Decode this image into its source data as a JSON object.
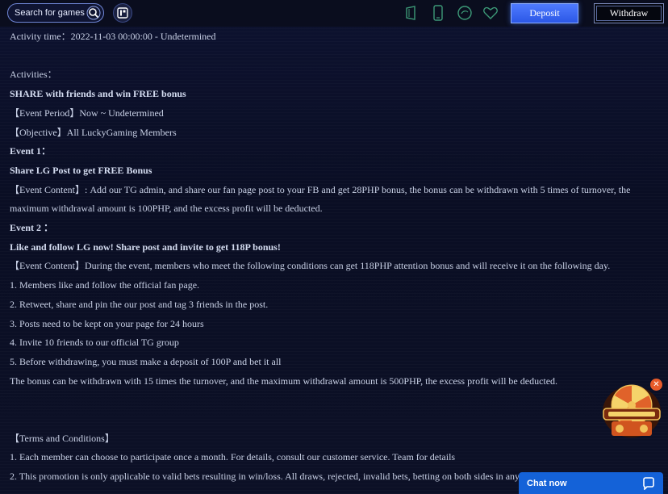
{
  "header": {
    "search_placeholder": "Search for games",
    "deposit_label": "Deposit",
    "withdraw_label": "Withdraw",
    "icons": [
      "search-icon",
      "menu-icon",
      "tablet-icon",
      "mobile-icon",
      "chat-bubble-icon",
      "heart-icon"
    ]
  },
  "content": {
    "activity_time": "Activity time：2022-11-03 00:00:00 - Undetermined",
    "activities_heading": "Activities：",
    "title": "SHARE with friends and win FREE bonus",
    "event_period": "【Event Period】Now ~ Undetermined",
    "objective": "【Objective】All LuckyGaming Members",
    "event1_heading": "Event 1：",
    "event1_title": "Share LG Post to get FREE Bonus",
    "event1_content_line1": "【Event Content】: Add our TG admin, and share our fan page post to your FB and get 28PHP bonus, the bonus can be withdrawn with 5 times of turnover, the",
    "event1_content_line2": "maximum withdrawal amount is 100PHP, and the excess profit will be deducted.",
    "event2_heading": "Event 2 ：",
    "event2_title": "Like and follow LG now! Share post and invite to get 118P bonus!",
    "event2_content": "【Event Content】During the event, members who meet the following conditions can get 118PHP attention bonus and will receive it on the following day.",
    "event2_conditions": [
      "1. Members like and follow the official fan page.",
      "2. Retweet, share and pin the our post and tag 3 friends in the post.",
      "3. Posts need to be kept on your page for 24 hours",
      "4. Invite 10 friends to our official TG group",
      "5. Before withdrawing, you must make a deposit of 100P and bet it all"
    ],
    "event2_bonus_note": "The bonus can be withdrawn with 15 times the turnover, and the maximum withdrawal amount is 500PHP,  the excess profit will be deducted.",
    "terms_heading": "【Terms and Conditions】",
    "terms": [
      "1. Each member can choose to participate once a month. For details, consult our customer service. Team for details",
      "2. This promotion is only applicable to valid bets resulting in win/loss. All draws, rejected, invalid bets, betting on both sides in any"
    ]
  },
  "promo": {
    "close_label": "✕"
  },
  "chat": {
    "label": "Chat now"
  },
  "colors": {
    "background": "#0b0f22",
    "deposit": "#2b57e6",
    "chat": "#1462d8",
    "text": "#c9d1e6"
  }
}
